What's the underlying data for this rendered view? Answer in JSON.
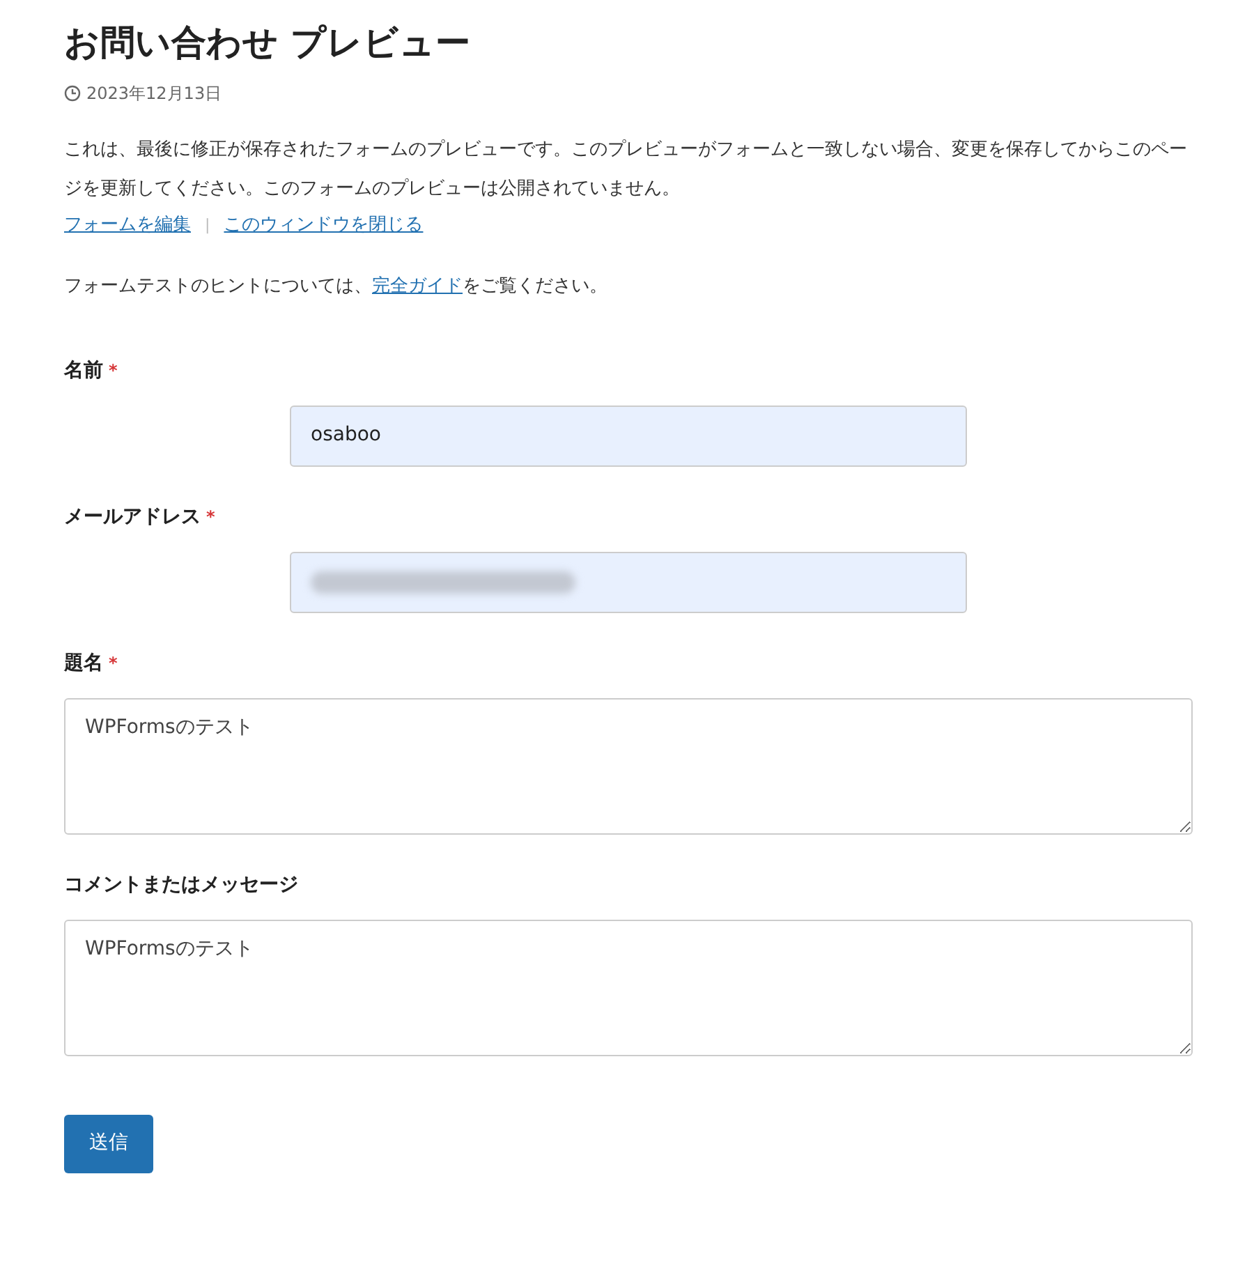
{
  "title": "お問い合わせ プレビュー",
  "date": "2023年12月13日",
  "notice": "これは、最後に修正が保存されたフォームのプレビューです。このプレビューがフォームと一致しない場合、変更を保存してからこのページを更新してください。このフォームのプレビューは公開されていません。",
  "links": [
    "フォームを編集",
    "このウィンドウを閉じる"
  ],
  "separator": "|",
  "hint": {
    "before": "フォームテストのヒントについては、",
    "link": "完全ガイド",
    "after": "をご覧ください。"
  },
  "fields": [
    {
      "label": "名前",
      "required": true,
      "kind": "input",
      "value": "osaboo"
    },
    {
      "label": "メールアドレス",
      "required": true,
      "kind": "input",
      "redacted": true
    },
    {
      "label": "題名",
      "required": true,
      "kind": "textarea",
      "value": "WPFormsのテスト"
    },
    {
      "label": "コメントまたはメッセージ",
      "required": false,
      "kind": "textarea",
      "value": "WPFormsのテスト"
    }
  ],
  "required_mark": "*",
  "submit": "送信"
}
